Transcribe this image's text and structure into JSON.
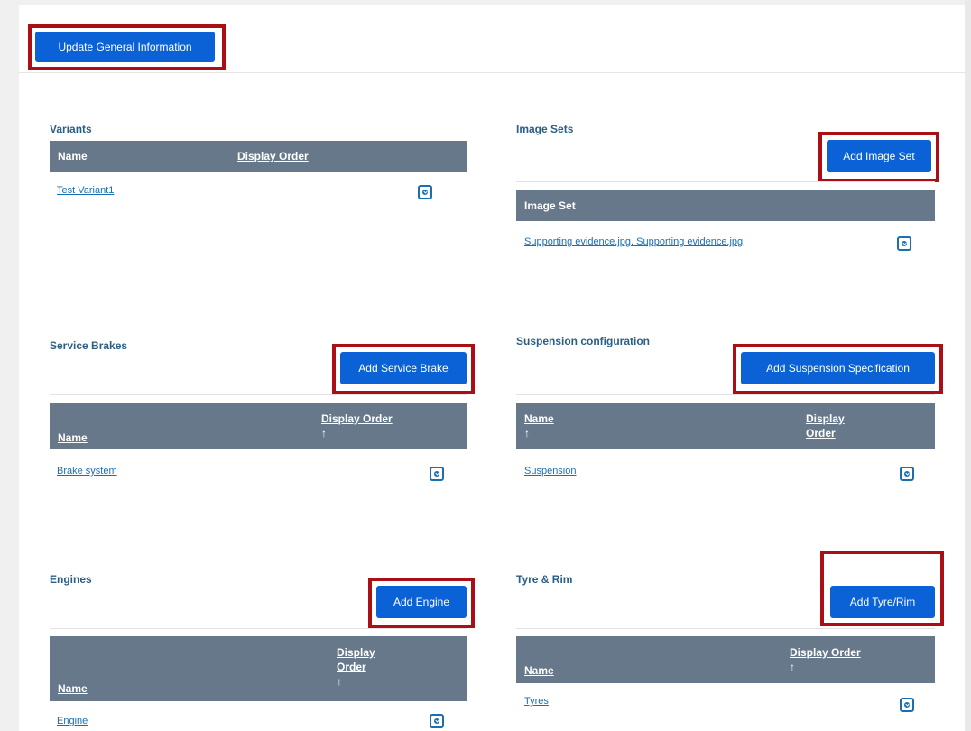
{
  "toolbar": {
    "update_label": "Update General Information"
  },
  "variants": {
    "title": "Variants",
    "col_name": "Name",
    "col_order": "Display Order",
    "rows": [
      "Test Variant1"
    ]
  },
  "image_sets": {
    "title": "Image Sets",
    "add_label": "Add Image Set",
    "col_set": "Image Set",
    "rows": [
      "Supporting evidence.jpg, Supporting evidence.jpg"
    ]
  },
  "service_brakes": {
    "title": "Service Brakes",
    "add_label": "Add Service Brake",
    "col_name": "Name",
    "col_order": "Display Order",
    "sort_arrow": "↑",
    "rows": [
      "Brake system"
    ]
  },
  "suspension": {
    "title": "Suspension configuration",
    "add_label": "Add Suspension Specification",
    "col_name": "Name",
    "col_order_1": "Display",
    "col_order_2": "Order",
    "sort_arrow": "↑",
    "rows": [
      "Suspension"
    ]
  },
  "engines": {
    "title": "Engines",
    "add_label": "Add Engine",
    "col_name": "Name",
    "col_order_1": "Display",
    "col_order_2": "Order",
    "sort_arrow": "↑",
    "rows": [
      "Engine"
    ]
  },
  "tyres": {
    "title": "Tyre & Rim",
    "add_label": "Add Tyre/Rim",
    "col_name": "Name",
    "col_order": "Display Order",
    "sort_arrow": "↑",
    "rows": [
      "Tyres"
    ]
  },
  "colors": {
    "accent": "#0b62d6",
    "highlight": "#a90f14",
    "header": "#66788a",
    "title": "#2b5f86",
    "link": "#1a6fb0"
  }
}
